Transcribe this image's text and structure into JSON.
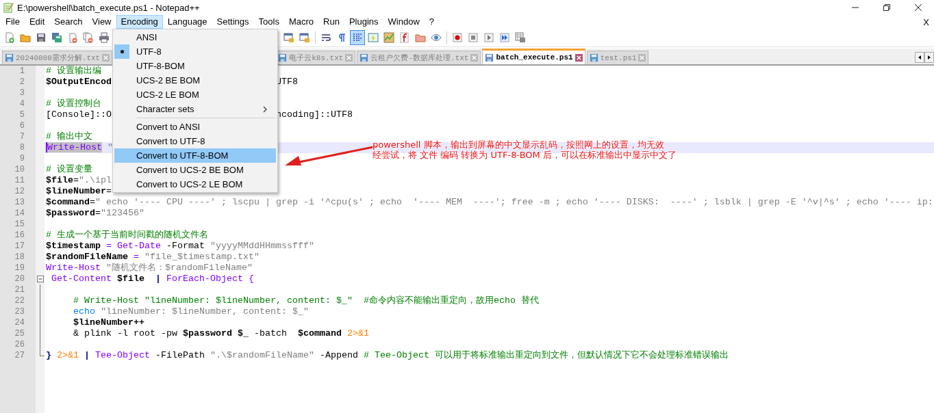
{
  "window": {
    "title": "E:\\powershell\\batch_execute.ps1 - Notepad++"
  },
  "menubar": {
    "items": [
      {
        "label": "File",
        "selected": false
      },
      {
        "label": "Edit",
        "selected": false
      },
      {
        "label": "Search",
        "selected": false
      },
      {
        "label": "View",
        "selected": false
      },
      {
        "label": "Encoding",
        "selected": true
      },
      {
        "label": "Language",
        "selected": false
      },
      {
        "label": "Settings",
        "selected": false
      },
      {
        "label": "Tools",
        "selected": false
      },
      {
        "label": "Macro",
        "selected": false
      },
      {
        "label": "Run",
        "selected": false
      },
      {
        "label": "Plugins",
        "selected": false
      },
      {
        "label": "Window",
        "selected": false
      },
      {
        "label": "?",
        "selected": false
      }
    ],
    "close_document": "X"
  },
  "toolbar": {
    "left": [
      {
        "kind": "new",
        "pressed": false
      },
      {
        "kind": "open",
        "pressed": false
      },
      {
        "kind": "save",
        "pressed": false
      },
      {
        "kind": "save-all",
        "pressed": false
      },
      {
        "kind": "close",
        "pressed": false
      },
      {
        "kind": "close-all",
        "pressed": false
      },
      {
        "kind": "print",
        "pressed": false
      }
    ],
    "right": [
      {
        "kind": "sync-v",
        "pressed": false
      },
      {
        "kind": "sync-h",
        "pressed": false
      },
      {
        "kind": "separator"
      },
      {
        "kind": "wrap",
        "pressed": false
      },
      {
        "kind": "pilcrow",
        "pressed": false
      },
      {
        "kind": "indent",
        "pressed": true
      },
      {
        "kind": "udl",
        "pressed": false
      },
      {
        "kind": "map",
        "pressed": false
      },
      {
        "kind": "function",
        "pressed": false
      },
      {
        "kind": "folder",
        "pressed": false
      },
      {
        "kind": "eye",
        "pressed": false
      },
      {
        "kind": "separator"
      },
      {
        "kind": "record",
        "pressed": false
      },
      {
        "kind": "stop",
        "pressed": false
      },
      {
        "kind": "play",
        "pressed": false
      },
      {
        "kind": "play-multi",
        "pressed": false
      },
      {
        "kind": "save-macro",
        "pressed": false
      }
    ]
  },
  "tabs": [
    {
      "label": "20240808需求分解.txt",
      "selected": false
    },
    {
      "label": "电子云k8s.txt",
      "selected": false
    },
    {
      "label": "云租户欠费-数据库处理.txt",
      "selected": false
    },
    {
      "label": "batch_execute.ps1",
      "selected": true
    },
    {
      "label": "test.ps1",
      "selected": false
    }
  ],
  "editor": {
    "lines": [
      {
        "number": "1",
        "highlighted": false,
        "left": [
          {
            "kind": "comment",
            "text": "# 设置输出编"
          }
        ]
      },
      {
        "number": "2",
        "highlighted": false,
        "left": [
          {
            "kind": "var",
            "text": "$OutputEncod"
          }
        ],
        "right": [
          {
            "kind": "plain",
            "text": "UTF8"
          }
        ]
      },
      {
        "number": "3",
        "highlighted": false
      },
      {
        "number": "4",
        "highlighted": false,
        "left": [
          {
            "kind": "comment",
            "text": "# 设置控制台"
          }
        ]
      },
      {
        "number": "5",
        "highlighted": false,
        "left": [
          {
            "kind": "plain",
            "text": "[Console]::O"
          }
        ],
        "right": [
          {
            "kind": "plain",
            "text": "ncoding]::UTF8"
          }
        ]
      },
      {
        "number": "6",
        "highlighted": false
      },
      {
        "number": "7",
        "highlighted": false,
        "left": [
          {
            "kind": "comment",
            "text": "# 输出中文"
          }
        ]
      },
      {
        "number": "8",
        "highlighted": true,
        "left": [
          {
            "kind": "selection",
            "text": "Write-Host"
          },
          {
            "kind": "string",
            "text": " \""
          }
        ]
      },
      {
        "number": "9",
        "highlighted": false
      },
      {
        "number": "10",
        "highlighted": false,
        "left": [
          {
            "kind": "comment",
            "text": "# 设置变量"
          }
        ]
      },
      {
        "number": "11",
        "highlighted": false,
        "left": [
          {
            "kind": "var",
            "text": "$file"
          },
          {
            "kind": "plain",
            "text": "="
          },
          {
            "kind": "string",
            "text": "\".\\ipl"
          }
        ]
      },
      {
        "number": "12",
        "highlighted": false,
        "left": [
          {
            "kind": "var",
            "text": "$lineNumber"
          },
          {
            "kind": "plain",
            "text": "="
          }
        ]
      },
      {
        "number": "13",
        "highlighted": false,
        "left": [
          {
            "kind": "var",
            "text": "$command"
          },
          {
            "kind": "plain",
            "text": "="
          },
          {
            "kind": "string",
            "text": "\" echo '---- CPU ----' ; lscpu | grep -i '^cpu(s' ; echo  '---- MEM  ----'; free -m ; echo '---- DISKS:  ----' ; lsblk | grep -E '^v|^s' ; echo '---- ip:"
          }
        ]
      },
      {
        "number": "14",
        "highlighted": false,
        "left": [
          {
            "kind": "var",
            "text": "$password"
          },
          {
            "kind": "plain",
            "text": "="
          },
          {
            "kind": "string",
            "text": "\"123456\""
          }
        ]
      },
      {
        "number": "15",
        "highlighted": false
      },
      {
        "number": "16",
        "highlighted": false,
        "left": [
          {
            "kind": "comment",
            "text": "# 生成一个基于当前时间戳的随机文件名"
          }
        ]
      },
      {
        "number": "17",
        "highlighted": false,
        "left": [
          {
            "kind": "var",
            "text": "$timestamp"
          },
          {
            "kind": "op",
            "text": " = "
          },
          {
            "kind": "cmdlet",
            "text": "Get-Date"
          },
          {
            "kind": "plain",
            "text": " -Format "
          },
          {
            "kind": "string",
            "text": "\"yyyyMMddHHmmssfff\""
          }
        ]
      },
      {
        "number": "18",
        "highlighted": false,
        "left": [
          {
            "kind": "var",
            "text": "$randomFileName"
          },
          {
            "kind": "op",
            "text": " = "
          },
          {
            "kind": "string",
            "text": "\"file_$timestamp.txt\""
          }
        ]
      },
      {
        "number": "19",
        "highlighted": false,
        "left": [
          {
            "kind": "cmdlet",
            "text": "Write-Host"
          },
          {
            "kind": "string",
            "text": " \"随机文件名：$randomFileName\""
          }
        ]
      },
      {
        "number": "20",
        "highlighted": false,
        "kind": "fold-start",
        "left": [
          {
            "kind": "cmdlet",
            "text": " Get-Content"
          },
          {
            "kind": "var",
            "text": " $file"
          },
          {
            "kind": "pipe",
            "text": "  |"
          },
          {
            "kind": "cmdlet",
            "text": " ForEach-Object {"
          }
        ]
      },
      {
        "number": "21",
        "highlighted": false,
        "kind": "fold-body"
      },
      {
        "number": "22",
        "highlighted": false,
        "kind": "fold-body",
        "left": [
          {
            "kind": "comment",
            "text": "     # Write-Host \"lineNumber: $lineNumber, content: $_\"  #命令内容不能输出重定向，故用echo 替代"
          }
        ]
      },
      {
        "number": "23",
        "highlighted": false,
        "kind": "fold-body",
        "left": [
          {
            "kind": "alias",
            "text": "     echo"
          },
          {
            "kind": "string",
            "text": " \"lineNumber: $lineNumber, content: $_\""
          }
        ]
      },
      {
        "number": "24",
        "highlighted": false,
        "kind": "fold-body",
        "left": [
          {
            "kind": "var",
            "text": "     $lineNumber++"
          }
        ]
      },
      {
        "number": "25",
        "highlighted": false,
        "kind": "fold-body",
        "left": [
          {
            "kind": "plain",
            "text": "     & plink -l root -pw "
          },
          {
            "kind": "var",
            "text": "$password"
          },
          {
            "kind": "var",
            "text": " $_"
          },
          {
            "kind": "plain",
            "text": " -batch  "
          },
          {
            "kind": "var",
            "text": "$command"
          },
          {
            "kind": "redirect",
            "text": " 2>&1"
          }
        ]
      },
      {
        "number": "26",
        "highlighted": false,
        "kind": "fold-body"
      },
      {
        "number": "27",
        "highlighted": false,
        "kind": "fold-end",
        "left": [
          {
            "kind": "brace",
            "text": "}"
          },
          {
            "kind": "redirect",
            "text": " 2>&1"
          },
          {
            "kind": "pipe",
            "text": " |"
          },
          {
            "kind": "cmdlet",
            "text": " Tee-Object"
          },
          {
            "kind": "plain",
            "text": " -FilePath "
          },
          {
            "kind": "string",
            "text": "\".\\$randomFileName\""
          },
          {
            "kind": "plain",
            "text": " -Append "
          },
          {
            "kind": "comment",
            "text": "# Tee-Object 可以用于将标准输出重定向到文件，但默认情况下它不会处理标准错误输出"
          }
        ]
      }
    ]
  },
  "encoding_menu": {
    "items": [
      {
        "kind": "item",
        "label": "ANSI",
        "checked": false,
        "selected": false
      },
      {
        "kind": "item",
        "label": "UTF-8",
        "checked": true,
        "selected": false
      },
      {
        "kind": "item",
        "label": "UTF-8-BOM",
        "checked": false,
        "selected": false
      },
      {
        "kind": "item",
        "label": "UCS-2 BE BOM",
        "checked": false,
        "selected": false
      },
      {
        "kind": "item",
        "label": "UCS-2 LE BOM",
        "checked": false,
        "selected": false
      },
      {
        "kind": "submenu",
        "label": "Character sets",
        "checked": false,
        "selected": false
      },
      {
        "kind": "separator"
      },
      {
        "kind": "item",
        "label": "Convert to ANSI",
        "checked": false,
        "selected": false
      },
      {
        "kind": "item",
        "label": "Convert to UTF-8",
        "checked": false,
        "selected": false
      },
      {
        "kind": "item",
        "label": "Convert to UTF-8-BOM",
        "checked": false,
        "selected": true
      },
      {
        "kind": "item",
        "label": "Convert to UCS-2 BE BOM",
        "checked": false,
        "selected": false
      },
      {
        "kind": "item",
        "label": "Convert to UCS-2 LE BOM",
        "checked": false,
        "selected": false
      }
    ]
  },
  "annotation": {
    "lines": [
      "powershell 脚本，输出到屏幕的中文显示乱码，按照网上的设置，均无效",
      "经尝试，将 文件 编码 转换为 UTF-8-BOM 后，可以在标准输出中显示中文了"
    ]
  }
}
